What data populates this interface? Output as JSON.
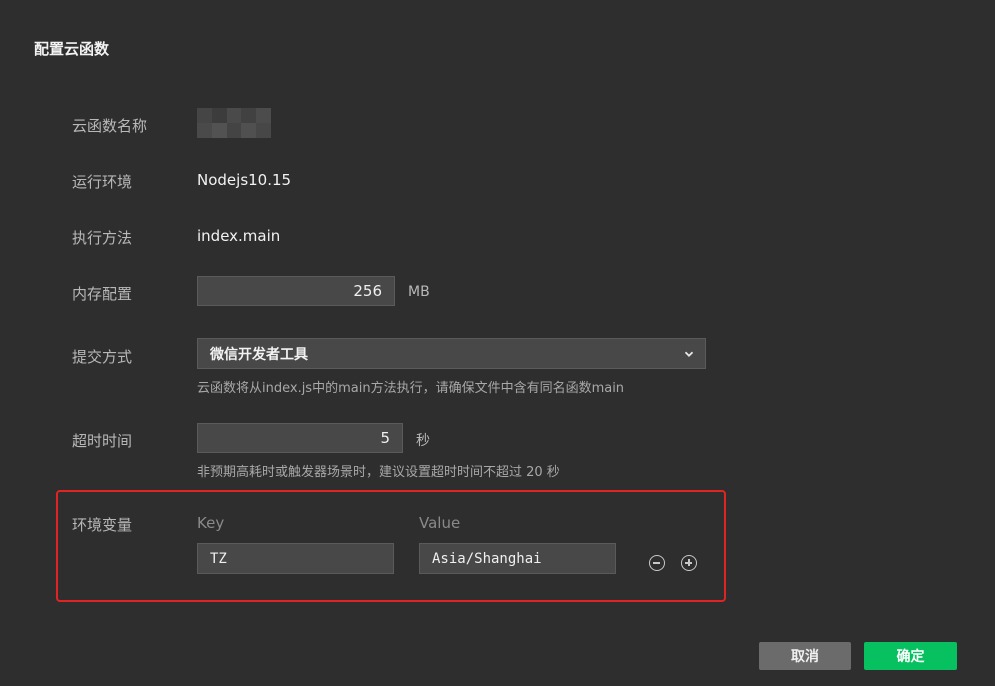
{
  "dialog": {
    "title": "配置云函数"
  },
  "fields": {
    "name_label": "云函数名称",
    "runtime_label": "运行环境",
    "runtime_value": "Nodejs10.15",
    "handler_label": "执行方法",
    "handler_value": "index.main",
    "memory_label": "内存配置",
    "memory_value": "256",
    "memory_unit": "MB",
    "submit_label": "提交方式",
    "submit_selected": "微信开发者工具",
    "submit_hint": "云函数将从index.js中的main方法执行，请确保文件中含有同名函数main",
    "timeout_label": "超时时间",
    "timeout_value": "5",
    "timeout_unit": "秒",
    "timeout_hint": "非预期高耗时或触发器场景时，建议设置超时时间不超过 20 秒"
  },
  "env_vars": {
    "label": "环境变量",
    "key_header": "Key",
    "value_header": "Value",
    "rows": [
      {
        "key": "TZ",
        "value": "Asia/Shanghai"
      }
    ]
  },
  "buttons": {
    "cancel": "取消",
    "confirm": "确定"
  },
  "colors": {
    "accent": "#07c160",
    "highlight": "#e02424",
    "background": "#2e2e2e"
  },
  "icons": {
    "dropdown": "chevron-down-icon",
    "remove": "minus-circle-icon",
    "add": "plus-circle-icon"
  }
}
